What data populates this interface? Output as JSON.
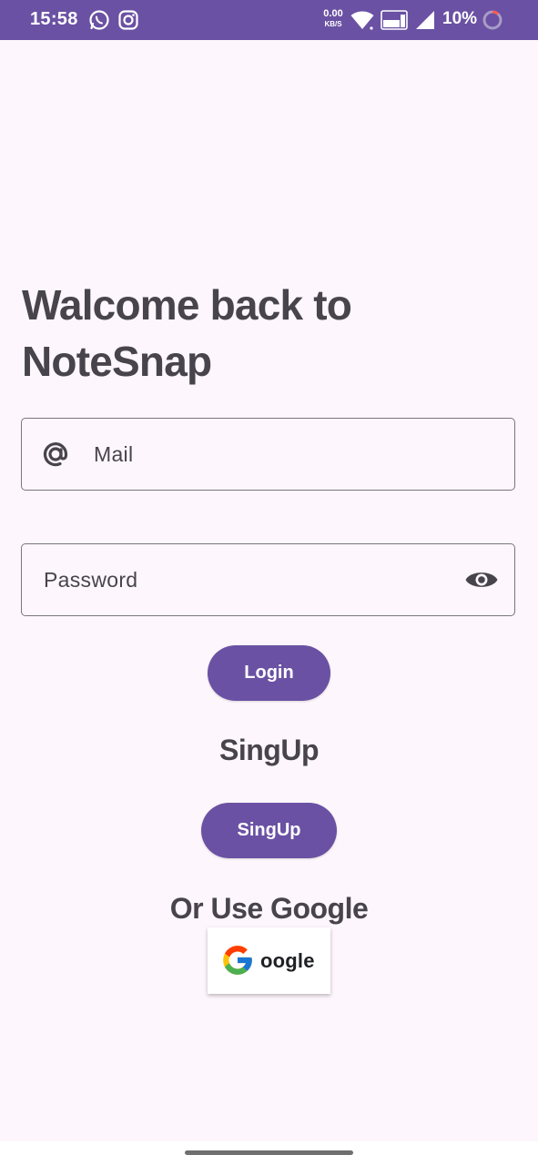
{
  "status_bar": {
    "time": "15:58",
    "net_speed": "0.00",
    "net_unit": "KB/S",
    "battery": "10%",
    "colors": {
      "background": "#6a51a3",
      "foreground": "#ffffff"
    },
    "icons": [
      "whatsapp-icon",
      "instagram-icon",
      "wifi-icon",
      "vowifi-icon",
      "signal-icon",
      "battery-ring-icon"
    ]
  },
  "login_screen": {
    "title_line1": "Walcome back to",
    "title_line2": "NoteSnap",
    "mail_field": {
      "placeholder": "Mail",
      "value": "",
      "icon": "at-icon"
    },
    "password_field": {
      "placeholder": "Password",
      "value": "",
      "icon": "eye-icon"
    },
    "login_button": "Login",
    "signup_heading": "SingUp",
    "signup_button": "SingUp",
    "google_heading": "Or Use Google",
    "google_button": {
      "label": "oogle",
      "icon": "google-g-icon"
    }
  },
  "theme": {
    "accent": "#6a51a3",
    "background": "#fdf6fc",
    "text": "#48444c"
  }
}
